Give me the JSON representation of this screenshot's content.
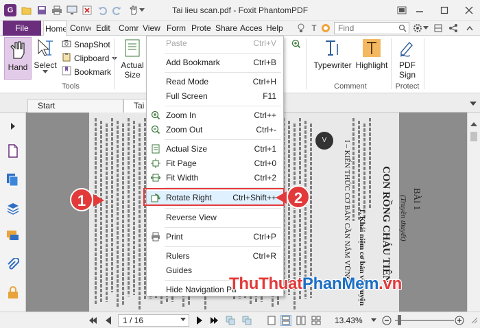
{
  "window": {
    "title": "Tai lieu scan.pdf - Foxit PhantomPDF",
    "logo_letter": "G"
  },
  "menubar": {
    "file": "File",
    "tabs": [
      "Home",
      "Conve",
      "Edit",
      "Comr",
      "View",
      "Form",
      "Prote",
      "Share",
      "Acces",
      "Help"
    ],
    "find_placeholder": "Find",
    "tell_letter": "T"
  },
  "ribbon": {
    "tools": {
      "hand": "Hand",
      "select": "Select",
      "snapshot": "SnapShot",
      "clipboard": "Clipboard",
      "bookmark": "Bookmark",
      "group": "Tools"
    },
    "actual_size": {
      "line1": "Actual",
      "line2": "Size"
    },
    "comment": {
      "typewriter": "Typewriter",
      "highlight": "Highlight",
      "group": "Comment"
    },
    "protect": {
      "line1": "PDF",
      "line2": "Sign",
      "group": "Protect"
    }
  },
  "doc_tabs": [
    "Start",
    "Tai li"
  ],
  "context_menu": {
    "items": [
      {
        "label": "Paste",
        "shortcut": "Ctrl+V",
        "disabled": true
      },
      {
        "label": "Add Bookmark",
        "shortcut": "Ctrl+B"
      },
      {
        "label": "Read Mode",
        "shortcut": "Ctrl+H"
      },
      {
        "label": "Full Screen",
        "shortcut": "F11"
      },
      {
        "label": "Zoom In",
        "shortcut": "Ctrl++"
      },
      {
        "label": "Zoom Out",
        "shortcut": "Ctrl+-"
      },
      {
        "label": "Actual Size",
        "shortcut": "Ctrl+1"
      },
      {
        "label": "Fit Page",
        "shortcut": "Ctrl+0"
      },
      {
        "label": "Fit Width",
        "shortcut": "Ctrl+2"
      },
      {
        "label": "Rotate Right",
        "shortcut": "Ctrl+Shift++",
        "highlighted": true
      },
      {
        "label": "Reverse View",
        "shortcut": ""
      },
      {
        "label": "Print",
        "shortcut": "Ctrl+P"
      },
      {
        "label": "Rulers",
        "shortcut": "Ctrl+R"
      },
      {
        "label": "Guides",
        "shortcut": ""
      },
      {
        "label": "Hide Navigation Pa",
        "shortcut": ""
      }
    ]
  },
  "page": {
    "heading_1": "BÀI 1",
    "heading_2": "CON RỒNG CHÁU TIÊN",
    "subheading": "(Truyền thuyết)",
    "section": "I – KIẾN THỨC CƠ BẢN CẦN NẮM VỮNG",
    "item_1": "1. Khái niệm cơ bản về truyện",
    "badge": "V"
  },
  "annotations": {
    "step1": "1",
    "step2": "2"
  },
  "statusbar": {
    "page_field": "1 / 16",
    "zoom": "13.43%"
  },
  "watermark": {
    "part1": "ThuThuat",
    "part2": "PhanMem",
    "part3": ".vn",
    "color1": "#e23a3a",
    "color2": "#1d6fc4",
    "color3": "#e23a3a"
  },
  "colors": {
    "brand": "#6b2e7d",
    "annotation": "#e23a3a",
    "menu_highlight": "#dff0ff"
  }
}
